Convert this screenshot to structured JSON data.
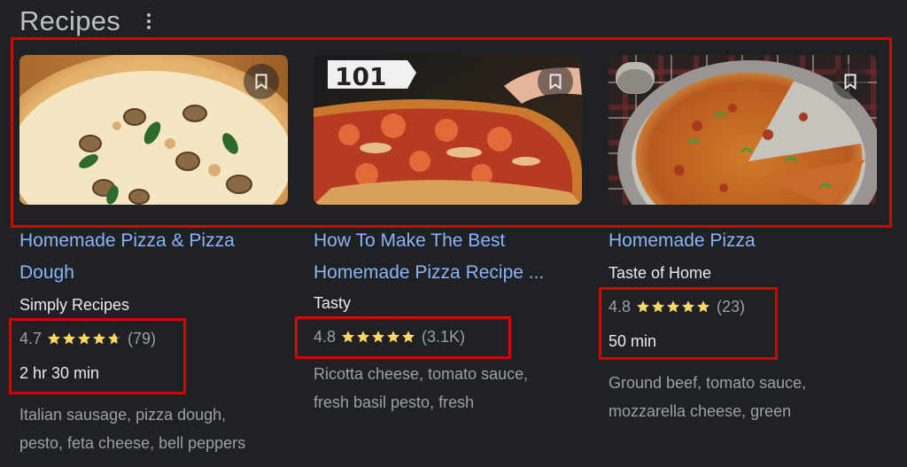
{
  "header": {
    "title": "Recipes",
    "menu_icon": "more-vert-icon"
  },
  "colors": {
    "background": "#202124",
    "link": "#8ab4f8",
    "star": "#fdd663",
    "highlight": "#d50000"
  },
  "recipes": [
    {
      "title_line1": "Homemade Pizza & Pizza",
      "title_line2": "Dough",
      "source": "Simply Recipes",
      "rating": "4.7",
      "stars": 4.7,
      "reviews": "(79)",
      "time": "2 hr 30 min",
      "ingredients_line1": "Italian sausage, pizza dough,",
      "ingredients_line2": "pesto, feta cheese, bell peppers"
    },
    {
      "title_line1": "How To Make The Best",
      "title_line2": "Homemade Pizza Recipe ...",
      "source": "Tasty",
      "rating": "4.8",
      "stars": 5,
      "reviews": "(3.1K)",
      "time": "",
      "ingredients_line1": "Ricotta cheese, tomato sauce,",
      "ingredients_line2": "fresh basil pesto, fresh",
      "image_text": "101"
    },
    {
      "title_line1": "Homemade Pizza",
      "source": "Taste of Home",
      "rating": "4.8",
      "stars": 5,
      "reviews": "(23)",
      "time": "50 min",
      "ingredients_line1": "Ground beef, tomato sauce,",
      "ingredients_line2": "mozzarella cheese, green"
    }
  ]
}
